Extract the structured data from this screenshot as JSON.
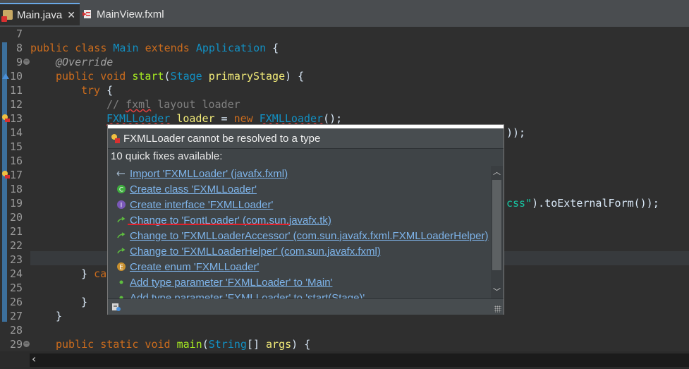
{
  "tabs": [
    {
      "label": "Main.java",
      "close": "✕",
      "icon": "java-file-error-icon"
    },
    {
      "label": "MainView.fxml",
      "icon": "fxml-file-icon"
    }
  ],
  "editor": {
    "lines": [
      {
        "n": "7"
      },
      {
        "n": "8"
      },
      {
        "n": "9"
      },
      {
        "n": "10"
      },
      {
        "n": "11"
      },
      {
        "n": "12"
      },
      {
        "n": "13"
      },
      {
        "n": "14"
      },
      {
        "n": "15"
      },
      {
        "n": "16"
      },
      {
        "n": "17"
      },
      {
        "n": "18"
      },
      {
        "n": "19"
      },
      {
        "n": "20"
      },
      {
        "n": "21"
      },
      {
        "n": "22"
      },
      {
        "n": "23"
      },
      {
        "n": "24"
      },
      {
        "n": "25"
      },
      {
        "n": "26"
      },
      {
        "n": "27"
      },
      {
        "n": "28"
      },
      {
        "n": "29"
      }
    ],
    "code": {
      "l8": {
        "kw1": "public class ",
        "name": "Main ",
        "kw2": "extends ",
        "type": "Application",
        "rest": " {"
      },
      "l9": {
        "text": "@Override"
      },
      "l10": {
        "kw": "public void ",
        "fn": "start",
        "p1": "(",
        "type": "Stage",
        "var": " primaryStage",
        "rest": ") {"
      },
      "l11": {
        "kw": "try",
        "rest": " {"
      },
      "l12": {
        "a": "// ",
        "u": "fxml",
        "b": " layout loader"
      },
      "l13": {
        "type1": "FXMLLoader",
        "var": " loader",
        "eq": " = ",
        "kw": "new ",
        "type2": "FXMLLoader",
        "rest": "();"
      },
      "l14": {
        "rest": "));"
      },
      "l19": {
        "str": "css\"",
        "rest": ").",
        "fn": "toExternalForm",
        "end": "());"
      },
      "l24": {
        "a": "} ",
        "kw": "ca"
      },
      "l26": {
        "text": "}"
      },
      "l27": {
        "text": "}"
      },
      "l29": {
        "kw": "public static void ",
        "fn": "main",
        "p1": "(",
        "type": "String",
        "mid": "[] ",
        "var": "args",
        "rest": ") {"
      }
    }
  },
  "quickfix": {
    "title": "FXMLLoader cannot be resolved to a type",
    "count": "10 quick fixes available:",
    "items": [
      {
        "label": "Import 'FXMLLoader' (javafx.fxml)",
        "icon": "import-icon"
      },
      {
        "label": "Create class 'FXMLLoader'",
        "icon": "class-icon"
      },
      {
        "label": "Create interface 'FXMLLoader'",
        "icon": "interface-icon"
      },
      {
        "label": "Change to 'FontLoader' (com.sun.javafx.tk)",
        "icon": "change-arrow-icon"
      },
      {
        "label": "Change to 'FXMLLoaderAccessor' (com.sun.javafx.fxml.FXMLLoaderHelper)",
        "icon": "change-arrow-icon"
      },
      {
        "label": "Change to 'FXMLLoaderHelper' (com.sun.javafx.fxml)",
        "icon": "change-arrow-icon"
      },
      {
        "label": "Create enum 'FXMLLoader'",
        "icon": "enum-icon"
      },
      {
        "label": "Add type parameter 'FXMLLoader' to 'Main'",
        "icon": "type-param-icon"
      },
      {
        "label": "Add type parameter 'FXMLLoader' to 'start(Stage)'",
        "icon": "type-param-icon"
      }
    ]
  },
  "colors": {
    "keyword": "#cc6c1d",
    "type": "#1290c3",
    "link": "#7eb4ea",
    "underline": "#e0202a"
  }
}
